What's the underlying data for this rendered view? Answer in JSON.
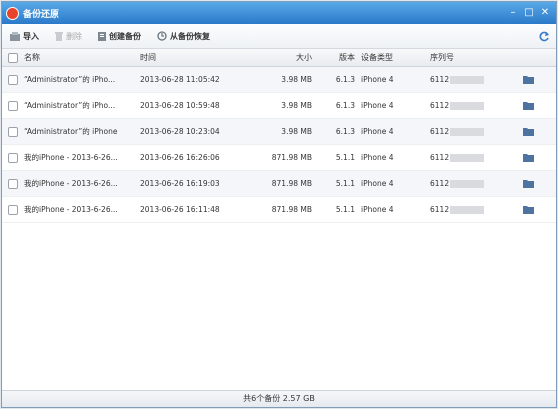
{
  "window": {
    "title": "备份还原",
    "minimize": "–",
    "maximize": "□",
    "close": "✕"
  },
  "toolbar": {
    "import_label": "导入",
    "delete_label": "删除",
    "create_backup_label": "创建备份",
    "restore_label": "从备份恢复"
  },
  "table": {
    "columns": [
      "名称",
      "时间",
      "大小",
      "版本",
      "设备类型",
      "序列号"
    ],
    "rows": [
      {
        "name": "“Administrator”的 iPho...",
        "time": "2013-06-28 11:05:42",
        "size": "3.98 MB",
        "version": "6.1.3",
        "device": "iPhone 4",
        "serial": "6112"
      },
      {
        "name": "“Administrator”的 iPho...",
        "time": "2013-06-28 10:59:48",
        "size": "3.98 MB",
        "version": "6.1.3",
        "device": "iPhone 4",
        "serial": "6112"
      },
      {
        "name": "“Administrator”的 iPhone",
        "time": "2013-06-28 10:23:04",
        "size": "3.98 MB",
        "version": "6.1.3",
        "device": "iPhone 4",
        "serial": "6112"
      },
      {
        "name": "我的iPhone - 2013-6-26...",
        "time": "2013-06-26 16:26:06",
        "size": "871.98 MB",
        "version": "5.1.1",
        "device": "iPhone 4",
        "serial": "6112"
      },
      {
        "name": "我的iPhone - 2013-6-26...",
        "time": "2013-06-26 16:19:03",
        "size": "871.98 MB",
        "version": "5.1.1",
        "device": "iPhone 4",
        "serial": "6112"
      },
      {
        "name": "我的iPhone - 2013-6-26...",
        "time": "2013-06-26 16:11:48",
        "size": "871.98 MB",
        "version": "5.1.1",
        "device": "iPhone 4",
        "serial": "6112"
      }
    ]
  },
  "status": {
    "summary": "共6个备份 2.57 GB"
  },
  "icons": {
    "import": "import-icon",
    "delete": "trash-icon",
    "create": "backup-icon",
    "restore": "restore-icon",
    "refresh": "refresh-icon",
    "folder": "folder-icon"
  }
}
